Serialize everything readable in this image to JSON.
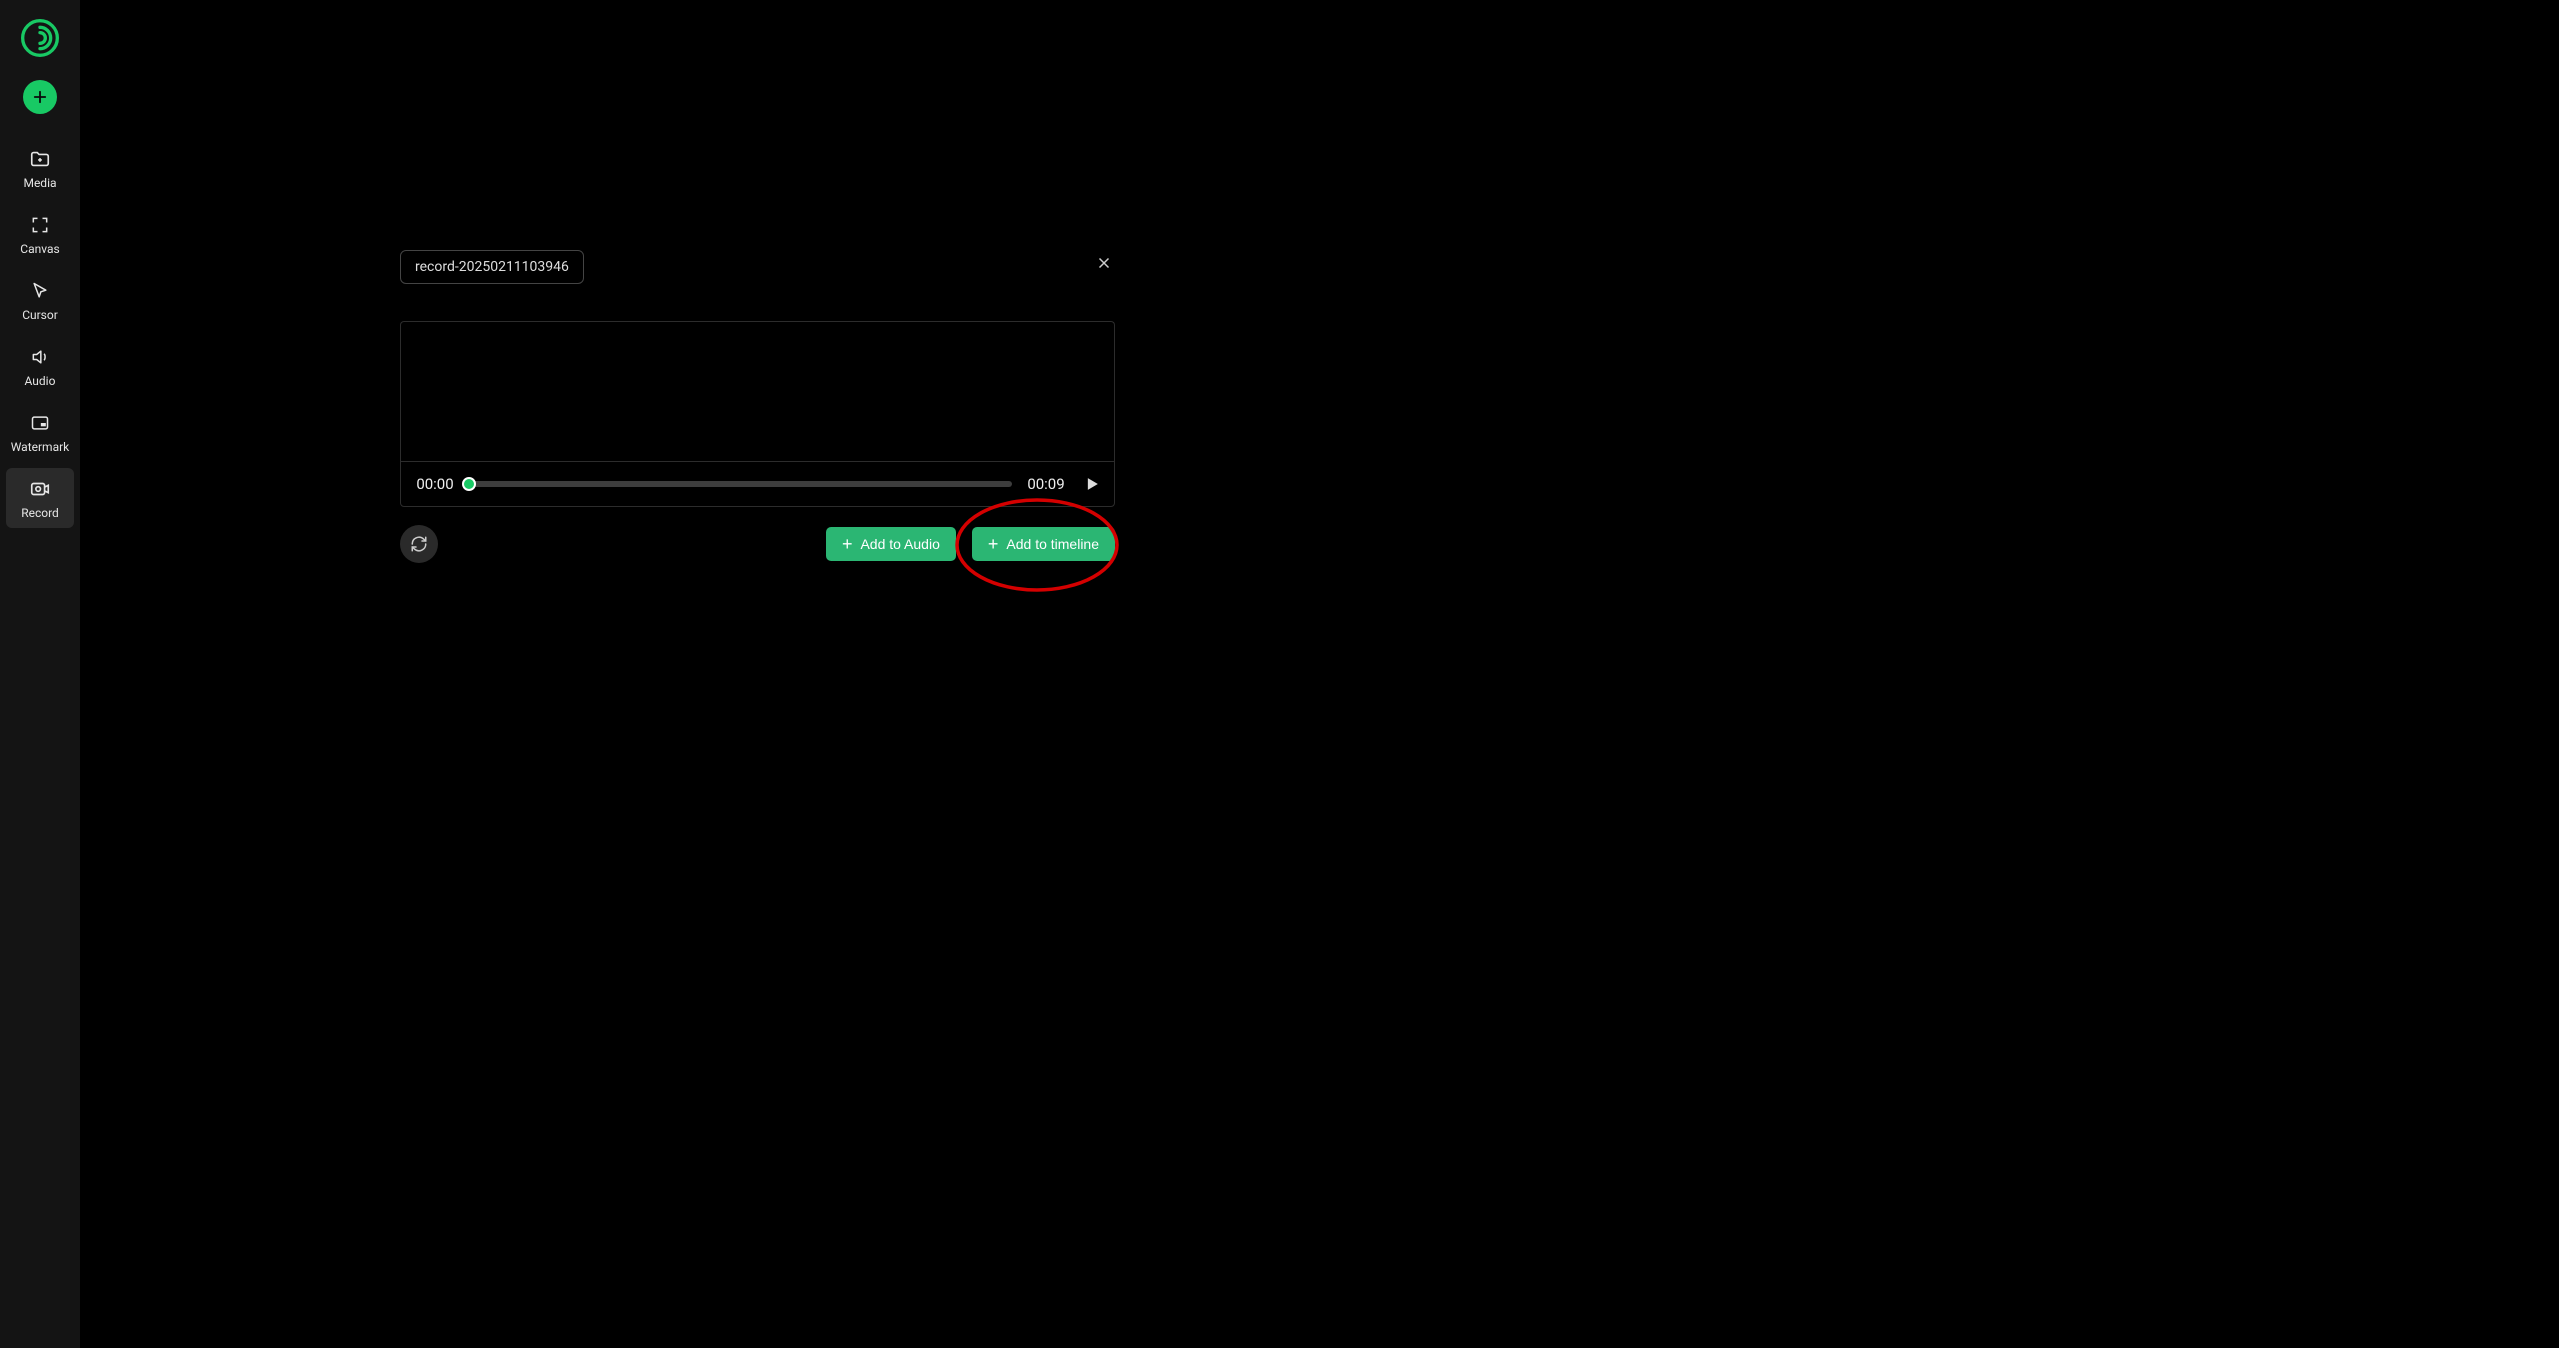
{
  "sidebar": {
    "items": [
      {
        "id": "media",
        "label": "Media"
      },
      {
        "id": "canvas",
        "label": "Canvas"
      },
      {
        "id": "cursor",
        "label": "Cursor"
      },
      {
        "id": "audio",
        "label": "Audio"
      },
      {
        "id": "watermark",
        "label": "Watermark"
      },
      {
        "id": "record",
        "label": "Record"
      }
    ],
    "active": "record"
  },
  "recording": {
    "filename": "record-20250211103946",
    "time_start": "00:00",
    "time_end": "00:09",
    "progress_percent": 0
  },
  "buttons": {
    "add_to_audio": "Add to Audio",
    "add_to_timeline": "Add to timeline"
  },
  "colors": {
    "accent": "#18c964",
    "button_green": "#2bb673",
    "sidebar_bg": "#141414",
    "annotation": "#d40000"
  }
}
